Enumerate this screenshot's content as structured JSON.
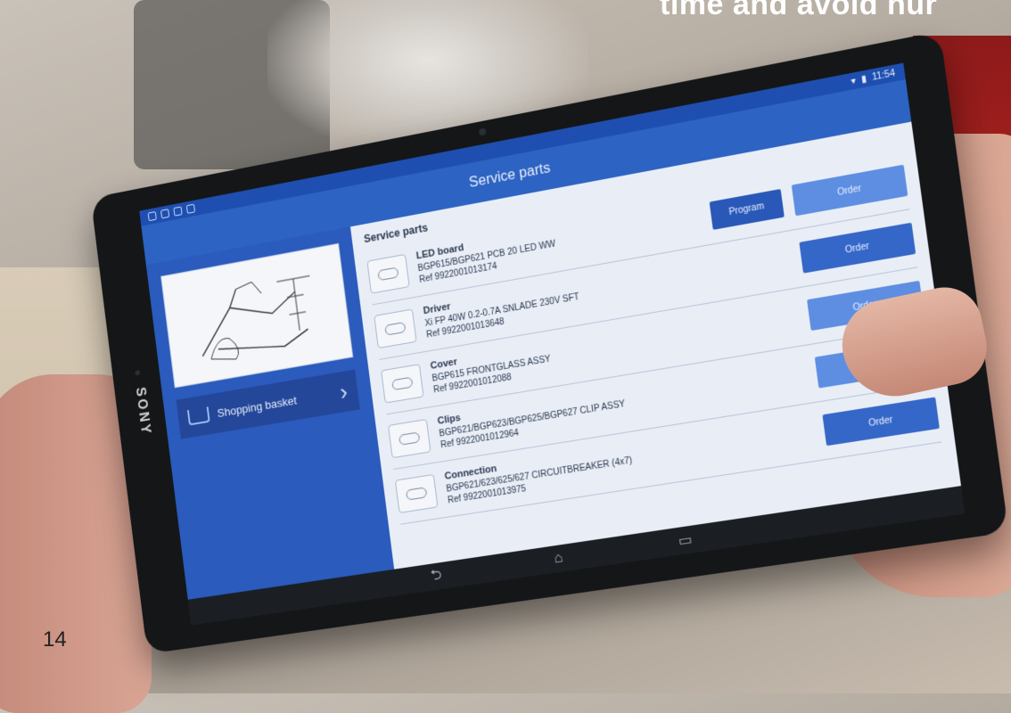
{
  "headline": "time and avoid hur",
  "page_number": "14",
  "device": {
    "brand": "SONY"
  },
  "statusbar": {
    "time": "11:54"
  },
  "app": {
    "title": "Service parts"
  },
  "sidebar": {
    "basket_label": "Shopping basket"
  },
  "content": {
    "section_title": "Service parts",
    "program_label": "Program",
    "order_label": "Order",
    "parts": [
      {
        "name": "LED board",
        "desc": "BGP615/BGP621 PCB 20 LED WW",
        "ref": "Ref 9922001013174"
      },
      {
        "name": "Driver",
        "desc": "Xi FP 40W 0.2-0.7A SNLADE 230V SFT",
        "ref": "Ref 9922001013648"
      },
      {
        "name": "Cover",
        "desc": "BGP615 FRONTGLASS ASSY",
        "ref": "Ref 9922001012088"
      },
      {
        "name": "Clips",
        "desc": "BGP621/BGP623/BGP625/BGP627 CLIP ASSY",
        "ref": "Ref 9922001012964"
      },
      {
        "name": "Connection",
        "desc": "BGP621/623/625/627 CIRCUITBREAKER (4x7)",
        "ref": "Ref 9922001013975"
      }
    ]
  },
  "navbar": {
    "back_icon": "back-icon",
    "home_icon": "home-icon",
    "recents_icon": "recents-icon"
  }
}
